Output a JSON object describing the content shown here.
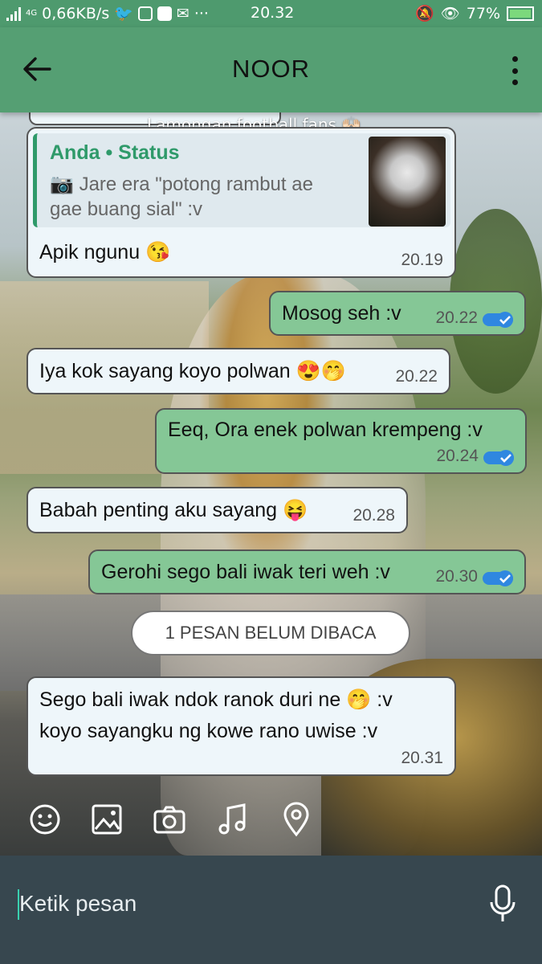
{
  "status_bar": {
    "network": "4G",
    "speed": "0,66KB/s",
    "time": "20.32",
    "battery": "77%"
  },
  "app_bar": {
    "title": "NOOR",
    "back_icon": "back-arrow-icon",
    "menu_icon": "more-vert-icon"
  },
  "colors": {
    "app_bar": "#559f73",
    "outgoing_bubble": "#85c796",
    "incoming_bubble": "#eef6fa",
    "input_bar": "#37474f"
  },
  "wallpaper_caption": "Lamongan football fans 🙌🏻",
  "messages": [
    {
      "direction": "in",
      "quote": {
        "name": "Anda • Status",
        "text": "Jare era \"potong rambut ae gae buang sial\" :v"
      },
      "text": "Apik ngunu 😘",
      "time": "20.19"
    },
    {
      "direction": "out",
      "text": "Mosog seh :v",
      "time": "20.22"
    },
    {
      "direction": "in",
      "text": "Iya kok sayang koyo polwan 😍🤭",
      "time": "20.22"
    },
    {
      "direction": "out",
      "text": "Eeq, Ora enek polwan krempeng :v",
      "time": "20.24"
    },
    {
      "direction": "in",
      "text": "Babah penting aku sayang 😝",
      "time": "20.28"
    },
    {
      "direction": "out",
      "text": "Gerohi sego bali iwak teri weh :v",
      "time": "20.30"
    },
    {
      "direction": "in",
      "text_line1": "Sego bali iwak ndok ranok duri ne 🤭 :v",
      "text_line2": "koyo sayangku ng kowe rano uwise :v",
      "time": "20.31"
    }
  ],
  "unread_banner": "1 PESAN BELUM DIBACA",
  "toolbar_icons": [
    "emoji-icon",
    "gallery-icon",
    "camera-icon",
    "music-icon",
    "location-icon"
  ],
  "input": {
    "placeholder": "Ketik pesan",
    "mic_icon": "mic-icon"
  }
}
